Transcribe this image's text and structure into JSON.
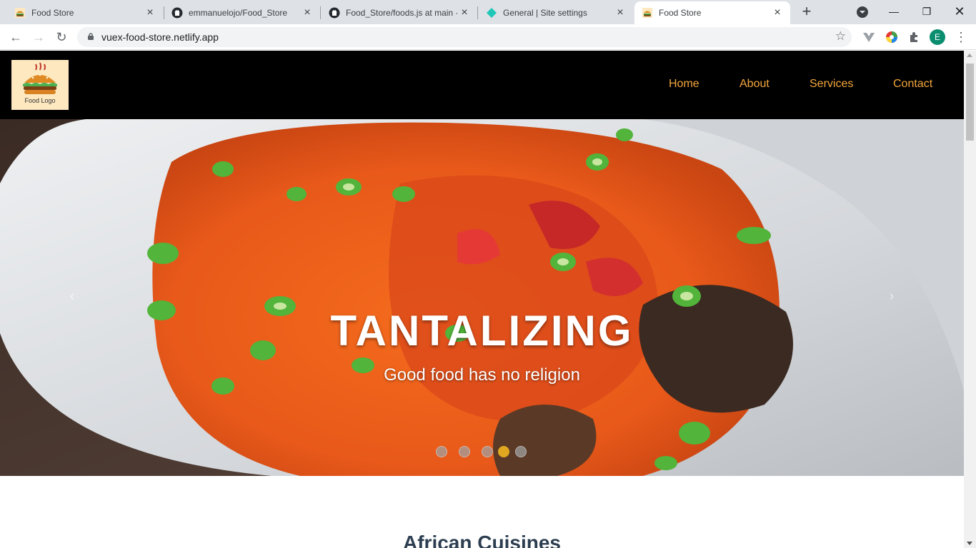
{
  "browser": {
    "tabs": [
      {
        "title": "Food Store",
        "favicon": "burger-icon",
        "active": false
      },
      {
        "title": "emmanuelojo/Food_Store",
        "favicon": "github-icon",
        "active": false
      },
      {
        "title": "Food_Store/foods.js at main ·",
        "favicon": "github-icon",
        "active": false
      },
      {
        "title": "General | Site settings",
        "favicon": "netlify-icon",
        "active": false
      },
      {
        "title": "Food Store",
        "favicon": "burger-icon",
        "active": true
      }
    ],
    "new_tab": "+",
    "address": "vuex-food-store.netlify.app",
    "profile_initial": "E"
  },
  "site": {
    "logo_text": "Food Logo",
    "nav": [
      "Home",
      "About",
      "Services",
      "Contact"
    ],
    "nav_color": "#f3a63b"
  },
  "hero": {
    "title": "TANTALIZING",
    "subtitle": "Good food has no religion",
    "prev_glyph": "‹",
    "next_glyph": "›",
    "slide_count": 5,
    "active_slide": 4
  },
  "section": {
    "heading": "African Cuisines"
  }
}
